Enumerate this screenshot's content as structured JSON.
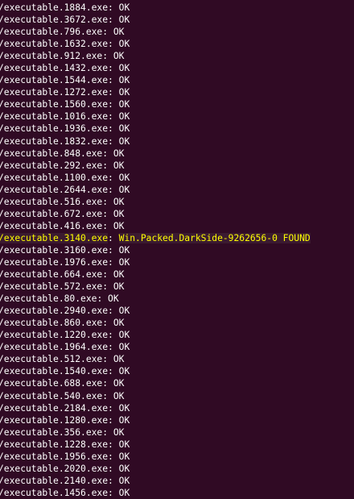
{
  "terminal": {
    "colors": {
      "background": "#300a24",
      "text": "#ffffff",
      "found_highlight_text": "#ffff00"
    },
    "lines": [
      {
        "path": "/executable.1884.exe",
        "status": "OK"
      },
      {
        "path": "/executable.3672.exe",
        "status": "OK"
      },
      {
        "path": "/executable.796.exe",
        "status": "OK"
      },
      {
        "path": "/executable.1632.exe",
        "status": "OK"
      },
      {
        "path": "/executable.912.exe",
        "status": "OK"
      },
      {
        "path": "/executable.1432.exe",
        "status": "OK"
      },
      {
        "path": "/executable.1544.exe",
        "status": "OK"
      },
      {
        "path": "/executable.1272.exe",
        "status": "OK"
      },
      {
        "path": "/executable.1560.exe",
        "status": "OK"
      },
      {
        "path": "/executable.1016.exe",
        "status": "OK"
      },
      {
        "path": "/executable.1936.exe",
        "status": "OK"
      },
      {
        "path": "/executable.1832.exe",
        "status": "OK"
      },
      {
        "path": "/executable.848.exe",
        "status": "OK"
      },
      {
        "path": "/executable.292.exe",
        "status": "OK"
      },
      {
        "path": "/executable.1100.exe",
        "status": "OK"
      },
      {
        "path": "/executable.2644.exe",
        "status": "OK"
      },
      {
        "path": "/executable.516.exe",
        "status": "OK"
      },
      {
        "path": "/executable.672.exe",
        "status": "OK"
      },
      {
        "path": "/executable.416.exe",
        "status": "OK"
      },
      {
        "path": "/executable.3140.exe",
        "status": "Win.Packed.DarkSide-9262656-0 FOUND",
        "found": true
      },
      {
        "path": "/executable.3160.exe",
        "status": "OK"
      },
      {
        "path": "/executable.1976.exe",
        "status": "OK"
      },
      {
        "path": "/executable.664.exe",
        "status": "OK"
      },
      {
        "path": "/executable.572.exe",
        "status": "OK"
      },
      {
        "path": "/executable.80.exe",
        "status": "OK"
      },
      {
        "path": "/executable.2940.exe",
        "status": "OK"
      },
      {
        "path": "/executable.860.exe",
        "status": "OK"
      },
      {
        "path": "/executable.1220.exe",
        "status": "OK"
      },
      {
        "path": "/executable.1964.exe",
        "status": "OK"
      },
      {
        "path": "/executable.512.exe",
        "status": "OK"
      },
      {
        "path": "/executable.1540.exe",
        "status": "OK"
      },
      {
        "path": "/executable.688.exe",
        "status": "OK"
      },
      {
        "path": "/executable.540.exe",
        "status": "OK"
      },
      {
        "path": "/executable.2184.exe",
        "status": "OK"
      },
      {
        "path": "/executable.1280.exe",
        "status": "OK"
      },
      {
        "path": "/executable.356.exe",
        "status": "OK"
      },
      {
        "path": "/executable.1228.exe",
        "status": "OK"
      },
      {
        "path": "/executable.1956.exe",
        "status": "OK"
      },
      {
        "path": "/executable.2020.exe",
        "status": "OK"
      },
      {
        "path": "/executable.2140.exe",
        "status": "OK"
      },
      {
        "path": "/executable.1456.exe",
        "status": "OK"
      }
    ]
  }
}
